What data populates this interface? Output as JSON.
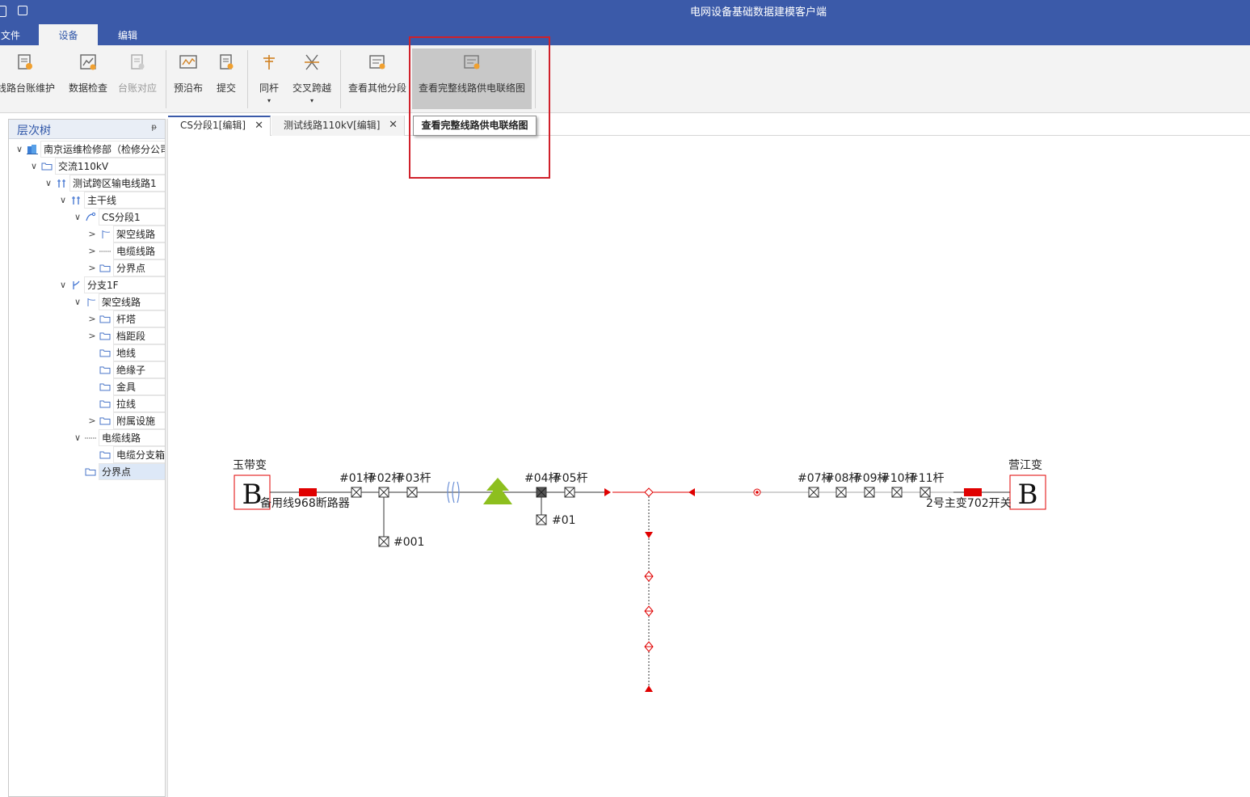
{
  "app": {
    "title": "电网设备基础数据建模客户端"
  },
  "menu": {
    "tabs": [
      "文件",
      "设备",
      "编辑"
    ],
    "active": "设备"
  },
  "ribbon": {
    "buttons": [
      {
        "label": "线路台账维护",
        "enabled": true
      },
      {
        "label": "数据检查",
        "enabled": true
      },
      {
        "label": "台账对应",
        "enabled": false
      },
      {
        "label": "预沿布",
        "enabled": true
      },
      {
        "label": "提交",
        "enabled": true
      },
      {
        "label": "同杆",
        "enabled": true
      },
      {
        "label": "交叉跨越",
        "enabled": true
      },
      {
        "label": "查看其他分段",
        "enabled": true
      },
      {
        "label": "查看完整线路供电联络图",
        "enabled": true
      }
    ],
    "tooltip": "查看完整线路供电联络图"
  },
  "tree": {
    "title": "层次树",
    "pin": "ᵽ",
    "nodes": [
      {
        "label": "南京运维检修部（检修分公司）",
        "expander": "∨",
        "icon": "building-icon"
      },
      {
        "label": "交流110kV",
        "expander": "∨",
        "icon": "folder-icon"
      },
      {
        "label": "测试跨区输电线路1",
        "expander": "∨",
        "icon": "line-icon"
      },
      {
        "label": "主干线",
        "expander": "∨",
        "icon": "line-icon"
      },
      {
        "label": "CS分段1",
        "expander": "∨",
        "icon": "segment-icon"
      },
      {
        "label": "架空线路",
        "expander": ">",
        "icon": "overhead-icon"
      },
      {
        "label": "电缆线路",
        "expander": ">",
        "icon": "cable-icon"
      },
      {
        "label": "分界点",
        "expander": ">",
        "icon": "folder-icon"
      },
      {
        "label": "分支1F",
        "expander": "∨",
        "icon": "branch-icon"
      },
      {
        "label": "架空线路",
        "expander": "∨",
        "icon": "overhead-icon"
      },
      {
        "label": "杆塔",
        "expander": ">",
        "icon": "folder-icon"
      },
      {
        "label": "档距段",
        "expander": ">",
        "icon": "folder-icon"
      },
      {
        "label": "地线",
        "expander": "",
        "icon": "folder-icon"
      },
      {
        "label": "绝缘子",
        "expander": "",
        "icon": "folder-icon"
      },
      {
        "label": "金具",
        "expander": "",
        "icon": "folder-icon"
      },
      {
        "label": "拉线",
        "expander": "",
        "icon": "folder-icon"
      },
      {
        "label": "附属设施",
        "expander": ">",
        "icon": "folder-icon"
      },
      {
        "label": "电缆线路",
        "expander": "∨",
        "icon": "cable-icon"
      },
      {
        "label": "电缆分支箱",
        "expander": "",
        "icon": "folder-icon"
      },
      {
        "label": "分界点",
        "expander": "",
        "icon": "folder-icon"
      }
    ]
  },
  "doc_tabs": [
    {
      "label": "CS分段1[编辑]",
      "close": "✕",
      "active": true
    },
    {
      "label": "测试线路110kV[编辑]",
      "close": "✕",
      "active": false
    }
  ],
  "diagram": {
    "left_station": {
      "name": "玉带变",
      "symbol": "B",
      "breaker": "备用线968断路器"
    },
    "right_station": {
      "name": "营江变",
      "symbol": "B",
      "breaker": "2号主变702开关"
    },
    "poles_left": [
      "#01杆",
      "#02杆",
      "#03杆"
    ],
    "poles_mid": [
      "#04杆",
      "#05杆"
    ],
    "poles_right": [
      "#07杆",
      "#08杆",
      "#09杆",
      "#10杆",
      "#11杆"
    ],
    "branch_a": "#001",
    "branch_b": "#01",
    "colors": {
      "line": "#333333",
      "red": "#e00000",
      "green": "#8dbf1e",
      "blue": "#6a8fd6"
    }
  }
}
